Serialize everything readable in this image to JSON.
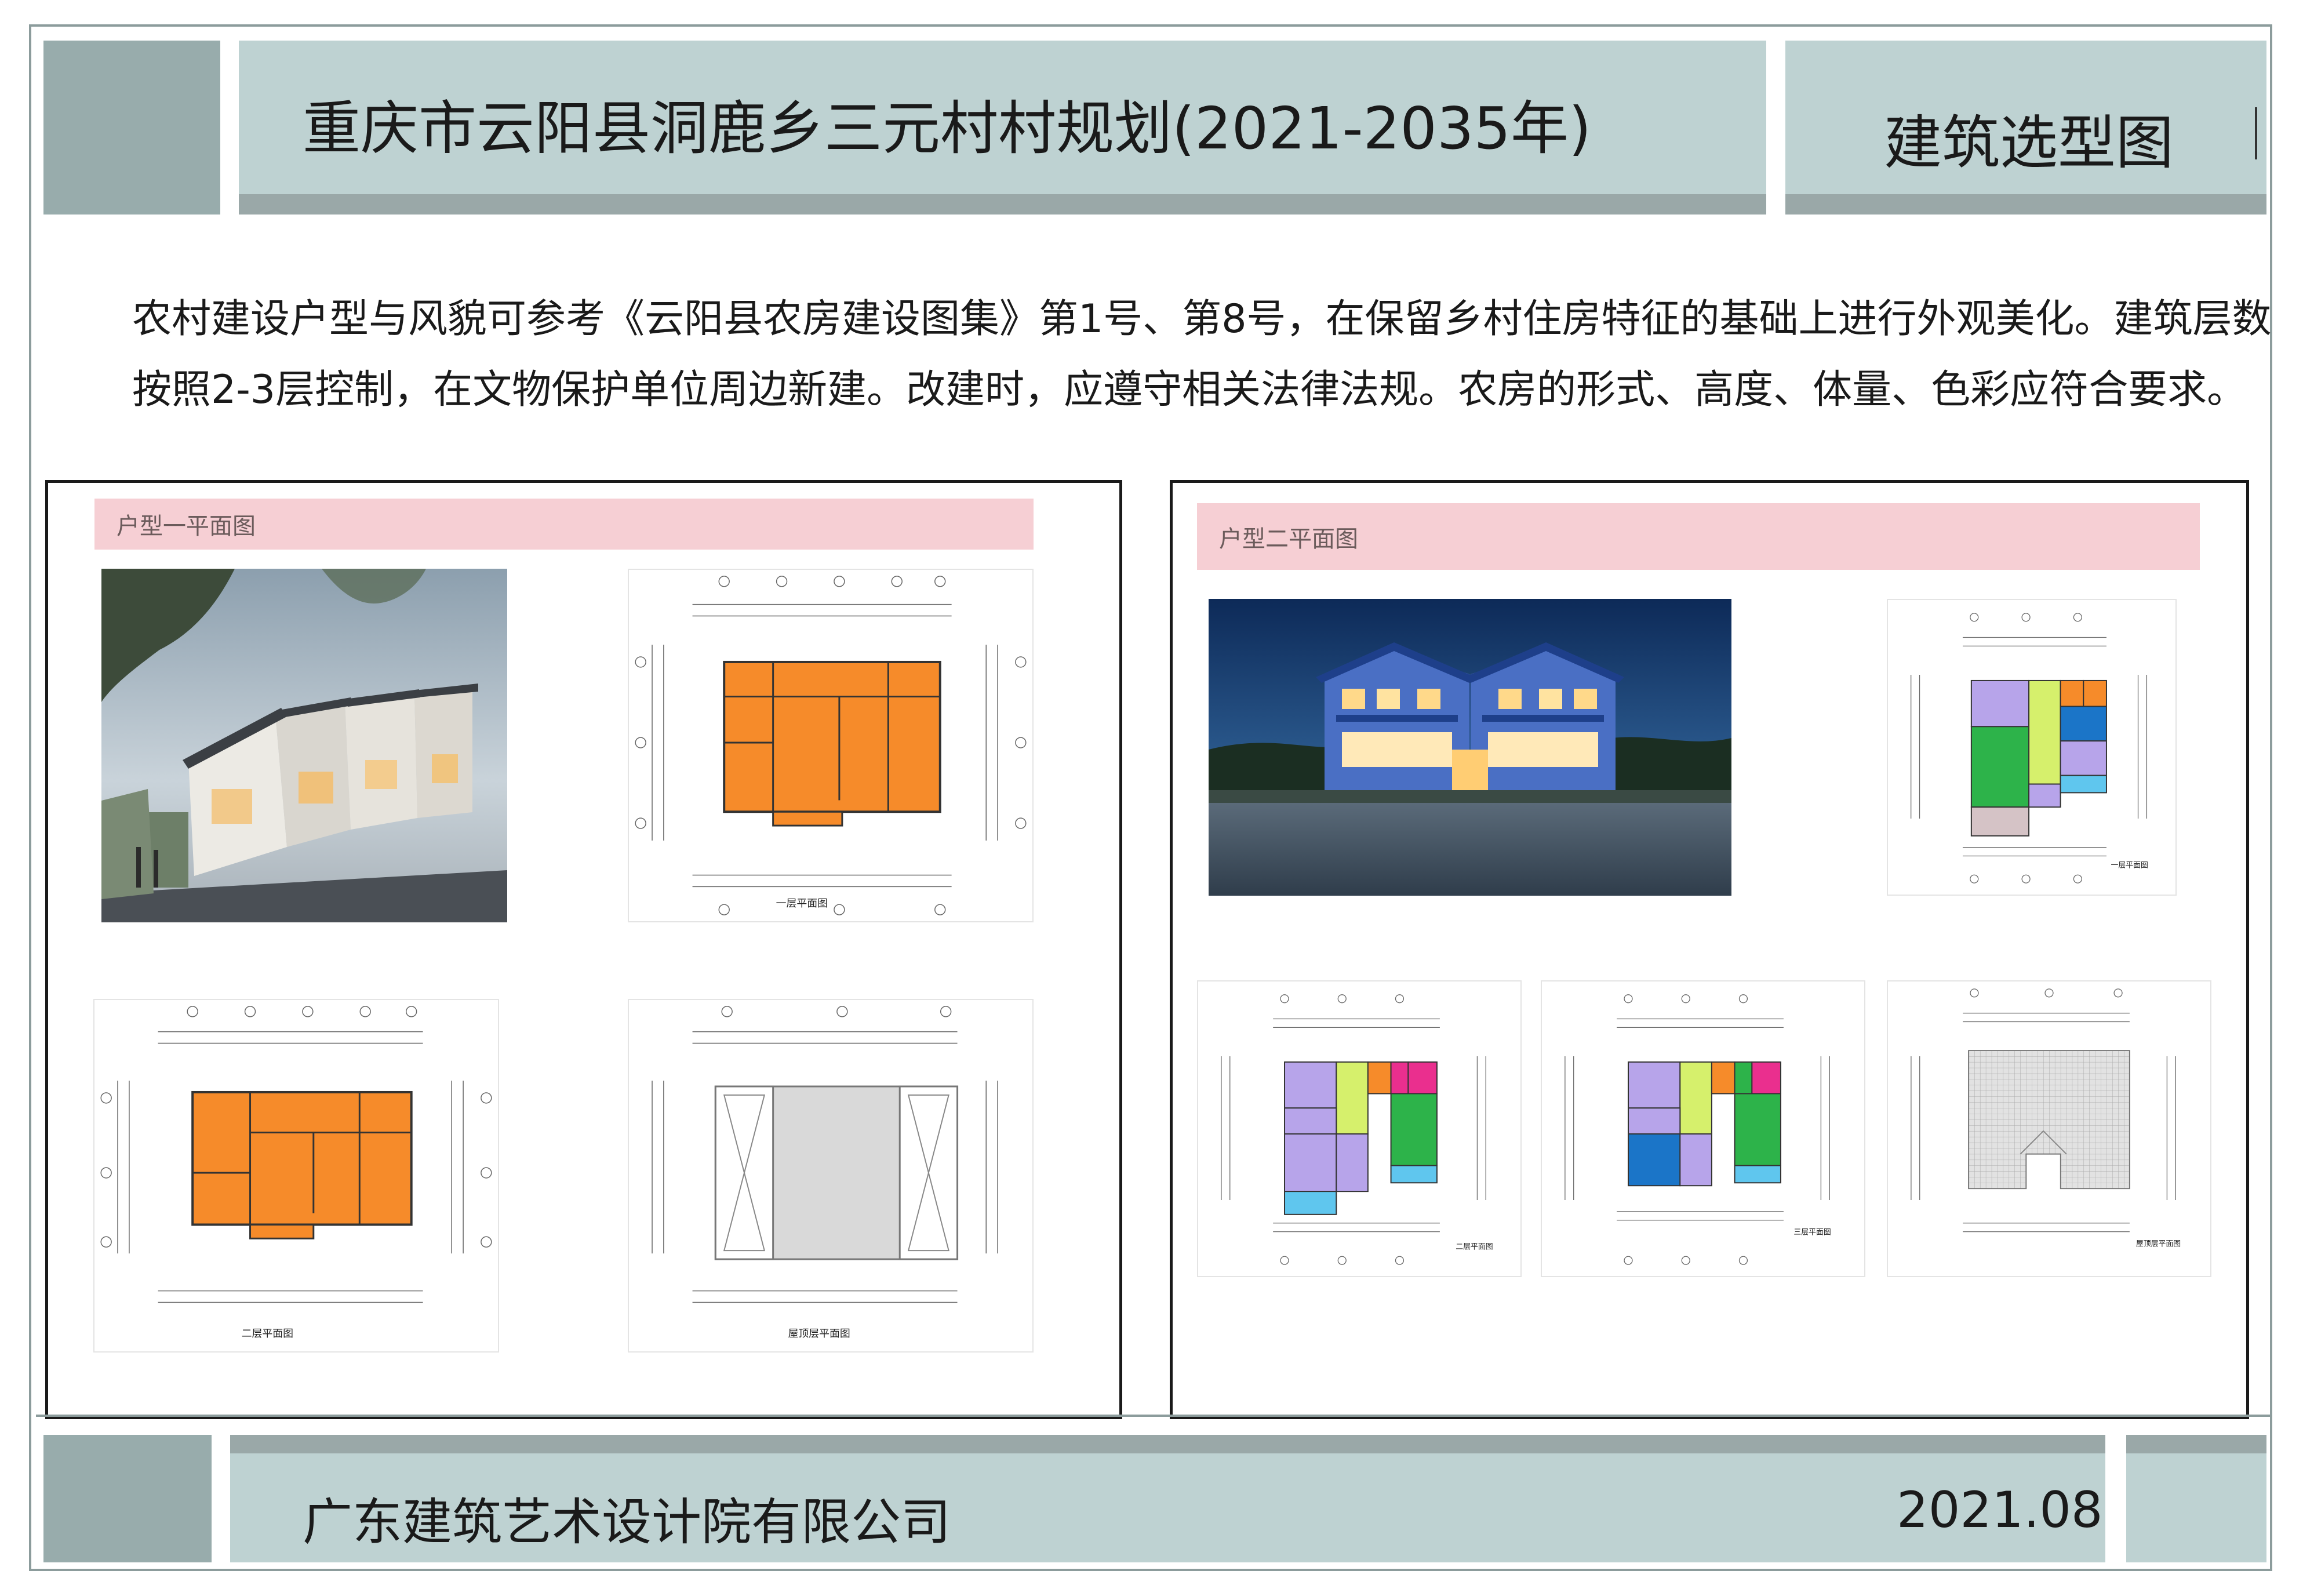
{
  "header": {
    "title": "重庆市云阳县洞鹿乡三元村村规划(2021-2035年)",
    "section_title": "建筑选型图"
  },
  "intro": {
    "line1": "农村建设户型与风貌可参考《云阳县农房建设图集》第1号、第8号，在保留乡村住房特征的基础上进行外观美化。建筑层数",
    "line2": "按照2-3层控制，在文物保护单位周边新建。改建时，应遵守相关法律法规。农房的形式、高度、体量、色彩应符合要求。"
  },
  "panel_type1": {
    "heading": "户型一平面图",
    "plan_ground_caption": "一层平面图",
    "plan_second_caption": "二层平面图",
    "plan_roof_caption": "屋顶层平面图"
  },
  "panel_type2": {
    "heading": "户型二平面图",
    "plan_ground_caption": "一层平面图",
    "plan_second_caption": "二层平面图",
    "plan_third_caption": "三层平面图",
    "plan_roof_caption": "屋顶层平面图"
  },
  "footer": {
    "company": "广东建筑艺术设计院有限公司",
    "date": "2021.08"
  },
  "colors": {
    "teal": "#bed2d2",
    "teal_dark": "#98acac",
    "pink_heading": "#f6cfd4",
    "plan_orange": "#f68b2a",
    "plan_green": "#2db34a",
    "plan_purple": "#b7a4ea",
    "plan_blue": "#1b75c8",
    "plan_lime": "#d6f06c",
    "plan_magenta": "#ea2f8e",
    "plan_cyan": "#5fc6ee"
  }
}
